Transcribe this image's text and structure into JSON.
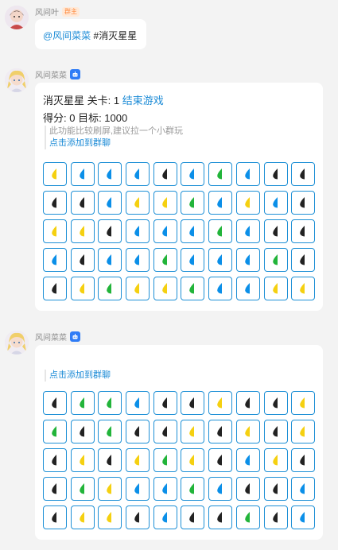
{
  "colors": {
    "yellow": "#f5d010",
    "blue": "#0b8fe8",
    "green": "#22b43a",
    "dark": "#222222",
    "link": "#1a8ad6",
    "cell_border": "#1e90d6"
  },
  "messages": {
    "m1": {
      "sender": "风间叶",
      "role": "群主",
      "mention": "@风间菜菜",
      "command": " #消灭星星"
    },
    "m2": {
      "sender": "风间菜菜",
      "game_title": "消灭星星 关卡: 1 ",
      "end_game": "结束游戏",
      "score_line": "得分: 0 目标: 1000",
      "tip": "此功能比较刷屏,建议拉一个小群玩",
      "add_link": "点击添加到群聊",
      "grid": [
        [
          "Y",
          "B",
          "B",
          "B",
          "D",
          "B",
          "G",
          "B",
          "D",
          "D"
        ],
        [
          "D",
          "D",
          "B",
          "Y",
          "Y",
          "G",
          "B",
          "Y",
          "B",
          "D"
        ],
        [
          "Y",
          "Y",
          "D",
          "B",
          "B",
          "B",
          "G",
          "B",
          "D",
          "D"
        ],
        [
          "B",
          "D",
          "B",
          "B",
          "G",
          "B",
          "B",
          "B",
          "G",
          "D"
        ],
        [
          "D",
          "Y",
          "G",
          "Y",
          "Y",
          "G",
          "B",
          "B",
          "Y",
          "Y"
        ]
      ]
    },
    "m3": {
      "sender": "风间菜菜",
      "add_link": "点击添加到群聊",
      "grid": [
        [
          "D",
          "G",
          "G",
          "B",
          "D",
          "D",
          "Y",
          "D",
          "D",
          "Y"
        ],
        [
          "G",
          "D",
          "G",
          "D",
          "D",
          "Y",
          "D",
          "Y",
          "D",
          "Y"
        ],
        [
          "D",
          "Y",
          "D",
          "Y",
          "G",
          "Y",
          "D",
          "B",
          "Y",
          "D"
        ],
        [
          "D",
          "G",
          "Y",
          "B",
          "B",
          "G",
          "B",
          "D",
          "D",
          "B"
        ],
        [
          "D",
          "Y",
          "Y",
          "D",
          "B",
          "D",
          "D",
          "G",
          "D",
          "B"
        ]
      ]
    }
  }
}
